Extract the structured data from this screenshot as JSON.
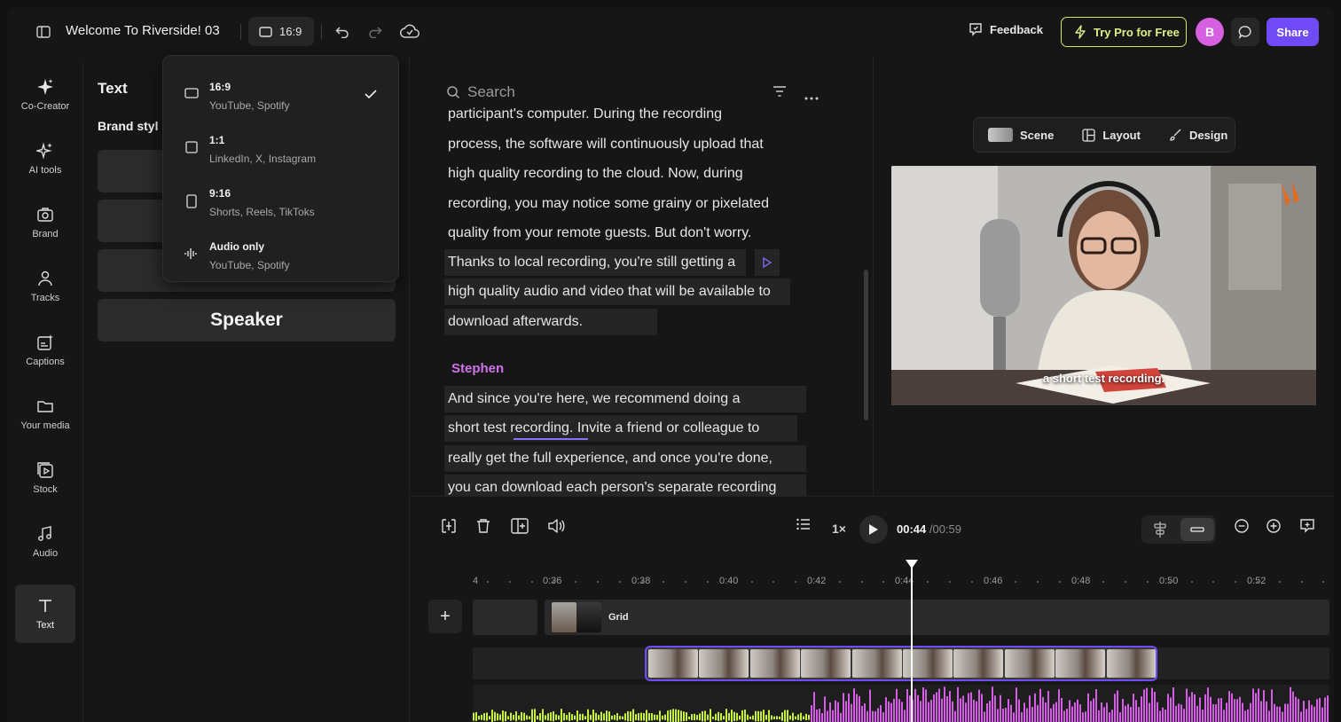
{
  "header": {
    "title": "Welcome To Riverside! 03",
    "aspect_ratio": "16:9",
    "feedback_label": "Feedback",
    "try_pro_label": "Try Pro for Free",
    "avatar_initial": "B",
    "share_label": "Share"
  },
  "sidebar": {
    "items": [
      {
        "label": "Co-Creator",
        "icon": "sparkle-icon"
      },
      {
        "label": "AI tools",
        "icon": "sparkles-icon"
      },
      {
        "label": "Brand",
        "icon": "brand-icon"
      },
      {
        "label": "Tracks",
        "icon": "people-icon"
      },
      {
        "label": "Captions",
        "icon": "captions-icon"
      },
      {
        "label": "Your media",
        "icon": "folder-icon"
      },
      {
        "label": "Stock",
        "icon": "stock-icon"
      },
      {
        "label": "Audio",
        "icon": "music-note-icon"
      },
      {
        "label": "Text",
        "icon": "text-icon"
      }
    ],
    "active": "Text"
  },
  "text_panel": {
    "title": "Text",
    "brand_style_label": "Brand styl",
    "speaker_label": "Speaker"
  },
  "aspect_dropdown": {
    "options": [
      {
        "label": "16:9",
        "sub": "YouTube, Spotify",
        "selected": true
      },
      {
        "label": "1:1",
        "sub": "LinkedIn, X, Instagram",
        "selected": false
      },
      {
        "label": "9:16",
        "sub": "Shorts, Reels, TikToks",
        "selected": false
      },
      {
        "label": "Audio only",
        "sub": "YouTube, Spotify",
        "selected": false
      }
    ]
  },
  "transcript": {
    "search_placeholder": "Search",
    "block1": [
      "participant's computer.  During the recording",
      "process, the software will continuously upload that",
      "high quality recording  to the cloud.  Now,  during",
      "recording, you may notice some grainy or pixelated",
      "quality from your remote guests.  But don't worry.",
      "Thanks to local recording,  you're still getting a",
      "high quality audio and video that will be available to",
      "download afterwards."
    ],
    "speaker": "Stephen",
    "block2": [
      "And since you're here,  we recommend doing a",
      "short test recording.  Invite  a friend or colleague to",
      "really  get the full experience,  and once you're done,",
      "you can download each person's separate recording"
    ]
  },
  "preview": {
    "scene_label": "Scene",
    "layout_label": "Layout",
    "design_label": "Design",
    "caption": "a short test recording."
  },
  "timeline": {
    "current_time": "00:44",
    "total_time": "/00:59",
    "speed": "1×",
    "ruler": [
      "4",
      "0:36",
      "0:38",
      "0:40",
      "0:42",
      "0:44",
      "0:46",
      "0:48",
      "0:50",
      "0:52"
    ],
    "grid_label": "Grid",
    "colors": {
      "accent": "#6f4af5",
      "wave_green": "#c6f03a",
      "wave_pink": "#d65ee6"
    }
  }
}
